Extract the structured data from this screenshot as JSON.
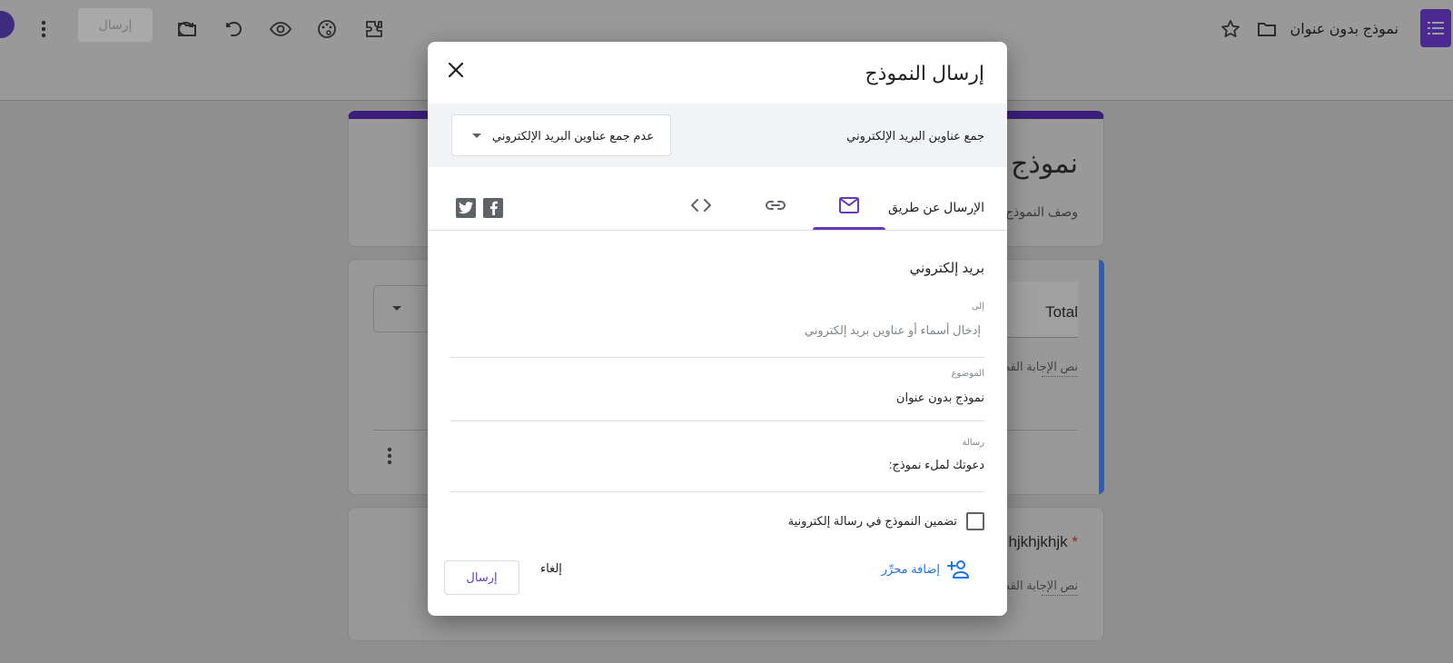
{
  "header": {
    "doc_title": "نموذج بدون عنوان",
    "send_label": "إرسال",
    "icons": [
      "forms-logo-icon",
      "star-icon",
      "folder-icon",
      "addon-icon",
      "palette-icon",
      "preview-eye-icon",
      "undo-icon",
      "redo-icon",
      "more-vert-icon",
      "avatar"
    ]
  },
  "background": {
    "form_title": "نموذج بدون عنوان",
    "form_desc": "وصف النموذج",
    "q1_title": "Total",
    "short_answer": "نص الإجابة القصيرة",
    "q2_title": "hjkhjkhjk",
    "required_mark": "*"
  },
  "dialog": {
    "title": "إرسال النموذج",
    "collect_label": "جمع عناوين البريد الإلكتروني",
    "collect_value": "عدم جمع عناوين البريد الإلكتروني",
    "send_via_label": "الإرسال عن طريق",
    "tabs": [
      {
        "name": "email",
        "icon": "mail-icon",
        "active": true
      },
      {
        "name": "link",
        "icon": "link-icon",
        "active": false
      },
      {
        "name": "embed",
        "icon": "code-icon",
        "active": false
      }
    ],
    "section_title": "بريد إلكتروني",
    "to": {
      "label": "إلى",
      "placeholder": "إدخال أسماء أو عناوين بريد إلكتروني"
    },
    "subject": {
      "label": "الموضوع",
      "value": "نموذج بدون عنوان"
    },
    "message": {
      "label": "رسالة",
      "value": "دعوتك لملء نموذج:"
    },
    "include_form_label": "تضمين النموذج في رسالة إلكترونية",
    "include_form_checked": false,
    "add_editor_label": "إضافة محرِّر",
    "cancel_label": "إلغاء",
    "send_label": "إرسال"
  },
  "colors": {
    "accent": "#673ab7",
    "link": "#1a73e8"
  }
}
